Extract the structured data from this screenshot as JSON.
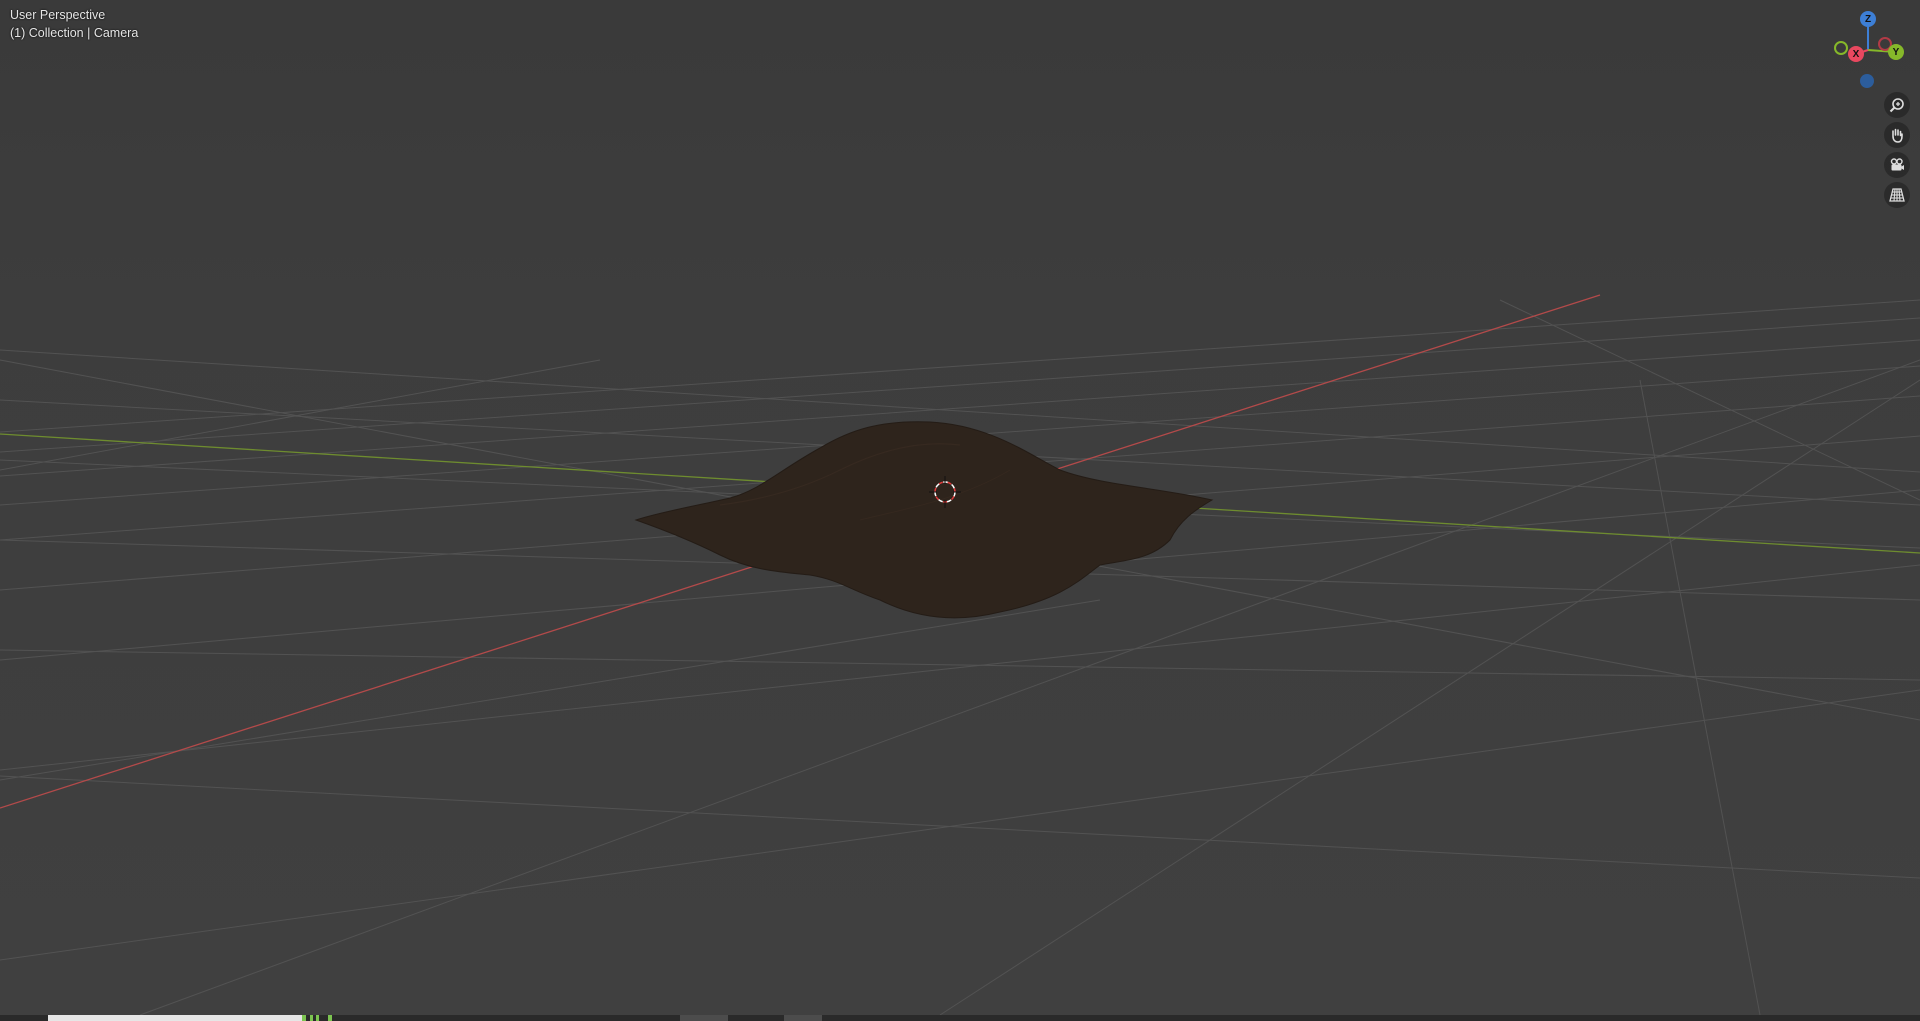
{
  "viewport": {
    "view_name": "User Perspective",
    "collection_info": "(1) Collection | Camera"
  },
  "gizmo": {
    "z_label": "Z",
    "x_label": "X",
    "y_label": "Y",
    "colors": {
      "x": "#e8485f",
      "y": "#86b82a",
      "z": "#3d7fd6",
      "neg_x": "#b23a46",
      "neg_y": "#5f8a22",
      "neg_z": "#2c5d9c"
    }
  },
  "nav_buttons": [
    {
      "name": "zoom-icon"
    },
    {
      "name": "pan-hand-icon"
    },
    {
      "name": "camera-view-icon"
    },
    {
      "name": "orthographic-grid-icon"
    }
  ],
  "scene": {
    "grid_color": "#555555",
    "x_axis_color": "#b34a4a",
    "y_axis_color": "#6e8c2f",
    "mesh_color": "#2e241c",
    "cursor_colors": [
      "#ffffff",
      "#e03a3a"
    ]
  }
}
